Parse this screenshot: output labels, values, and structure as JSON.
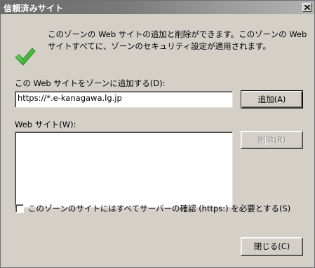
{
  "window": {
    "title": "信頼済みサイト"
  },
  "info": {
    "text": "このゾーンの Web サイトの追加と削除ができます。このゾーンの Web サイトすべてに、ゾーンのセキュリティ設定が適用されます。"
  },
  "add_section": {
    "label": "この Web サイトをゾーンに追加する(D):",
    "input_value": "https://*.e-kanagawa.lg.jp",
    "add_button": "追加(A)"
  },
  "sites_section": {
    "label": "Web サイト(W):",
    "items": [],
    "remove_button": "削除(R)"
  },
  "https_checkbox": {
    "label": "このゾーンのサイトにはすべてサーバーの確認 (https:) を必要とする(S)",
    "checked": false
  },
  "footer": {
    "close_button": "閉じる(C)"
  }
}
